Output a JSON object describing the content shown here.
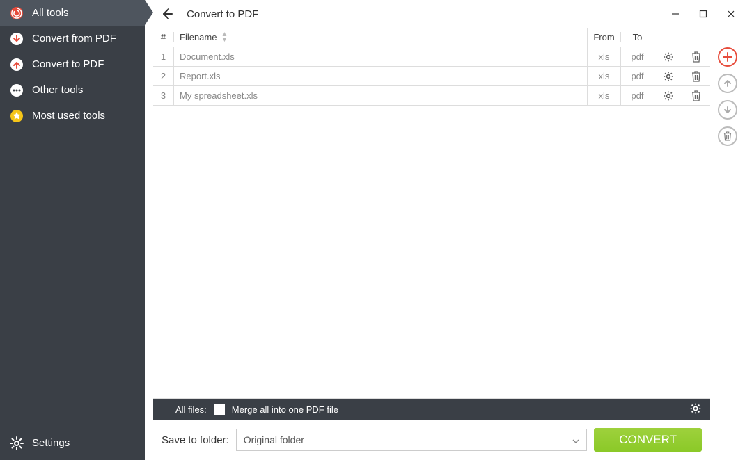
{
  "sidebar": {
    "items": [
      {
        "label": "All tools"
      },
      {
        "label": "Convert from PDF"
      },
      {
        "label": "Convert to PDF"
      },
      {
        "label": "Other tools"
      },
      {
        "label": "Most used tools"
      }
    ],
    "settings_label": "Settings"
  },
  "header": {
    "title": "Convert to PDF"
  },
  "table": {
    "columns": {
      "idx": "#",
      "filename": "Filename",
      "from": "From",
      "to": "To"
    },
    "rows": [
      {
        "idx": "1",
        "name": "Document.xls",
        "from": "xls",
        "to": "pdf"
      },
      {
        "idx": "2",
        "name": "Report.xls",
        "from": "xls",
        "to": "pdf"
      },
      {
        "idx": "3",
        "name": "My spreadsheet.xls",
        "from": "xls",
        "to": "pdf"
      }
    ]
  },
  "allfiles": {
    "prefix": "All files:",
    "merge_label": "Merge all into one PDF file"
  },
  "footer": {
    "save_label": "Save to folder:",
    "folder_value": "Original folder",
    "convert_label": "CONVERT"
  }
}
